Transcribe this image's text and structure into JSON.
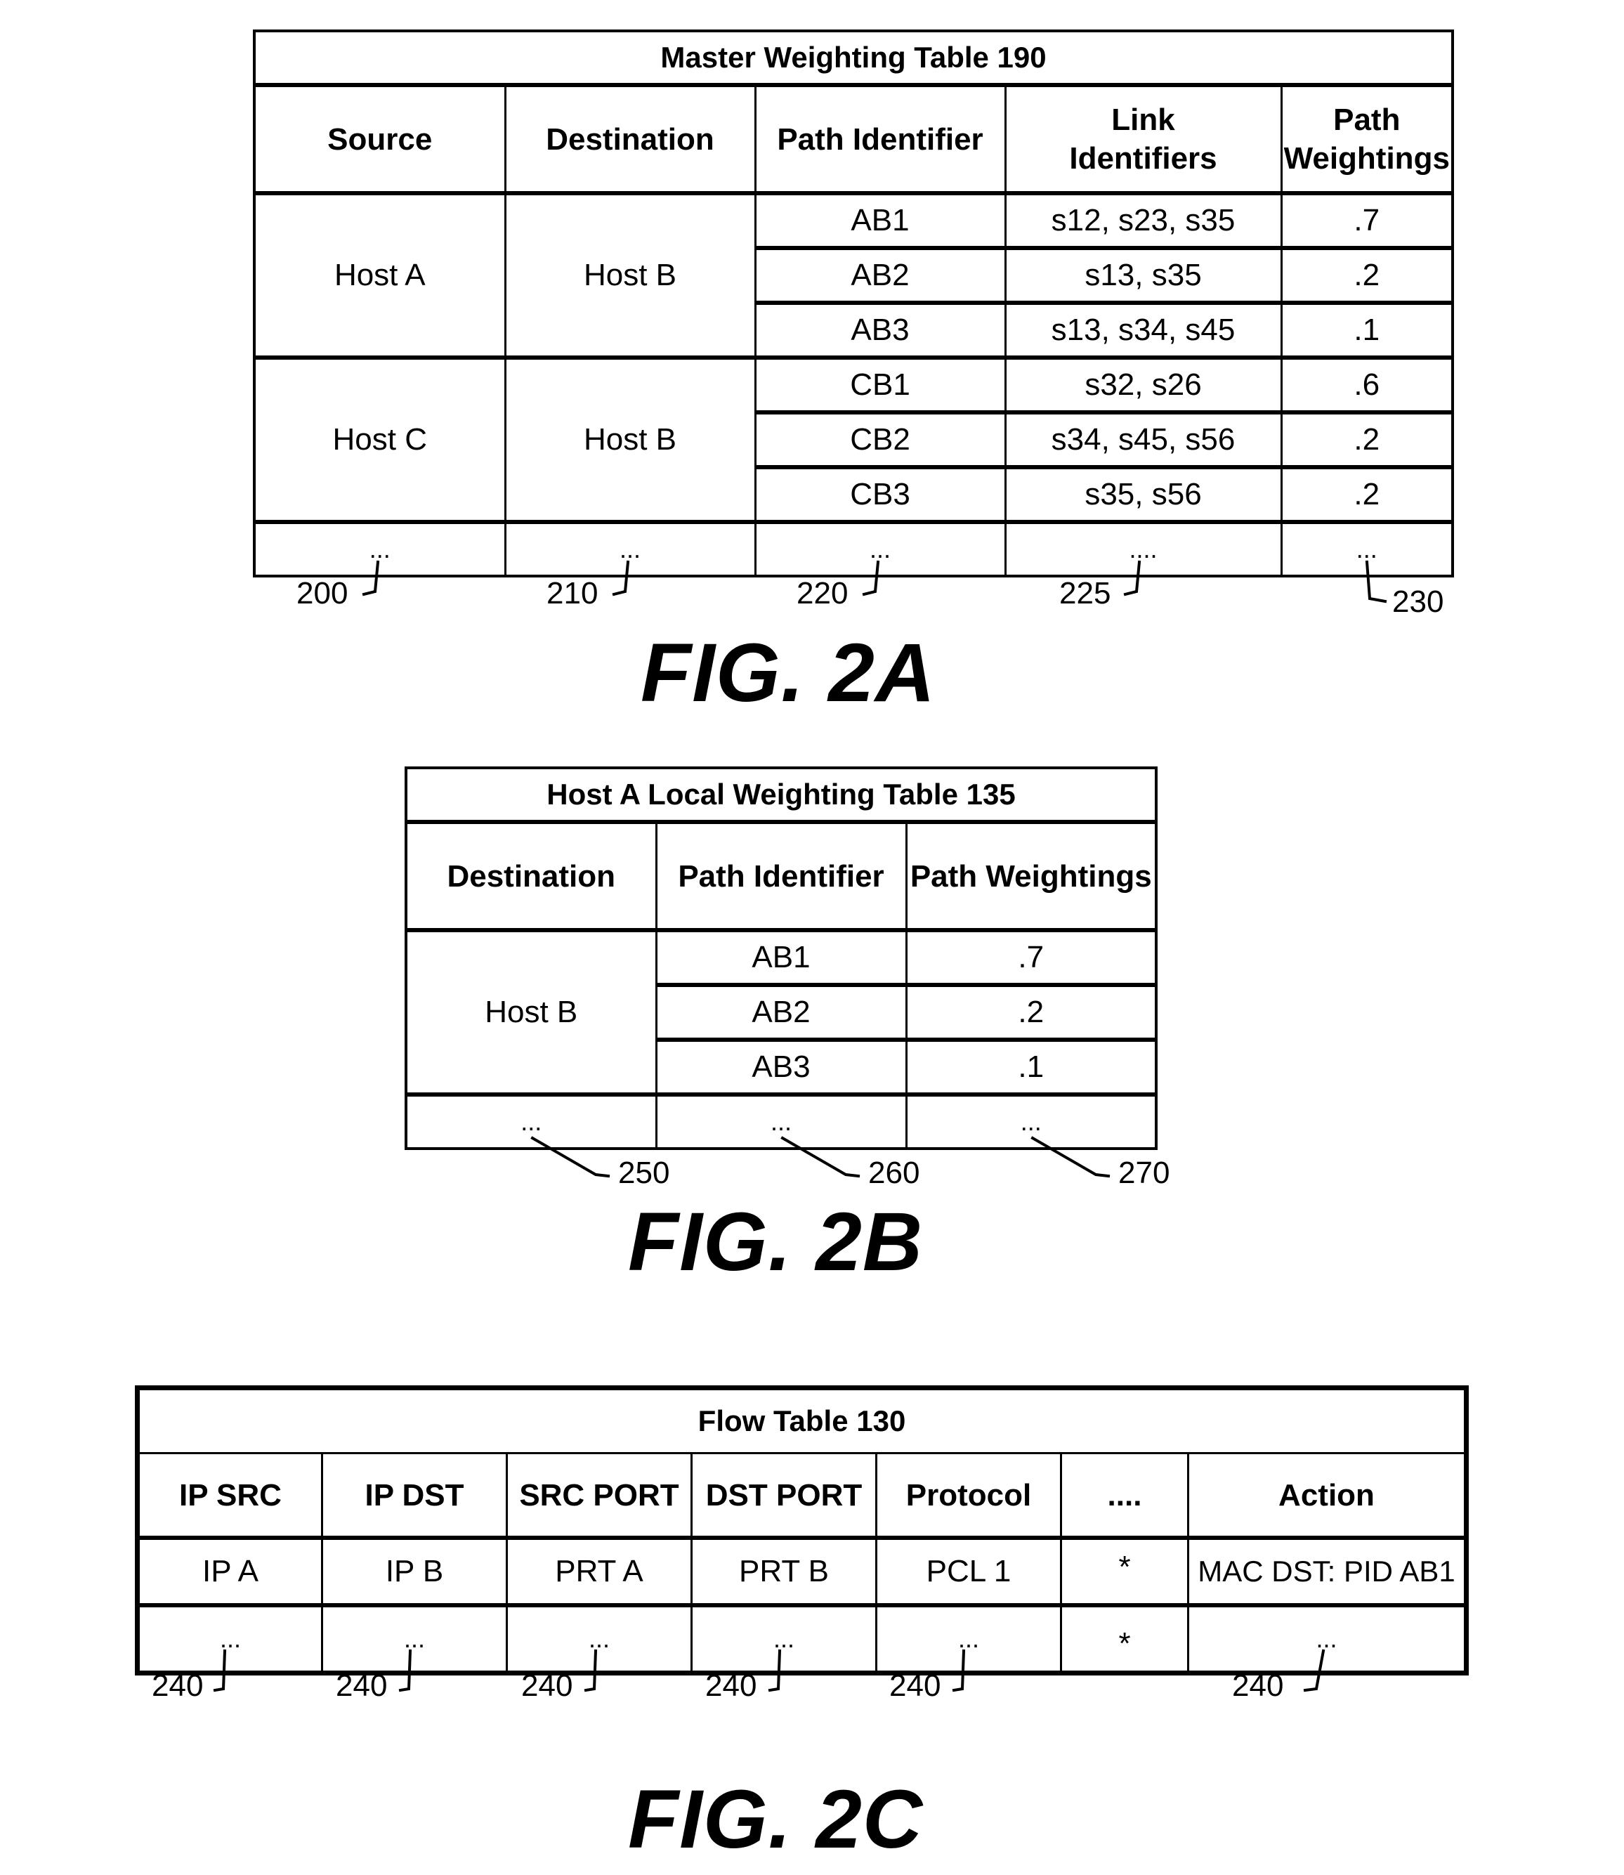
{
  "fig2a": {
    "title": "Master Weighting Table 190",
    "headers": [
      "Source",
      "Destination",
      "Path Identifier",
      "Link Identifiers",
      "Path Weightings"
    ],
    "header_lines": {
      "link_identifiers": [
        "Link",
        "Identifiers"
      ],
      "path_weightings": [
        "Path",
        "Weightings"
      ]
    },
    "groups": [
      {
        "source": "Host A",
        "destination": "Host B",
        "paths": [
          {
            "id": "AB1",
            "links": "s12, s23, s35",
            "weight": ".7"
          },
          {
            "id": "AB2",
            "links": "s13, s35",
            "weight": ".2"
          },
          {
            "id": "AB3",
            "links": "s13, s34, s45",
            "weight": ".1"
          }
        ]
      },
      {
        "source": "Host C",
        "destination": "Host B",
        "paths": [
          {
            "id": "CB1",
            "links": "s32, s26",
            "weight": ".6"
          },
          {
            "id": "CB2",
            "links": "s34, s45, s56",
            "weight": ".2"
          },
          {
            "id": "CB3",
            "links": "s35, s56",
            "weight": ".2"
          }
        ]
      }
    ],
    "ellipsis_row": [
      "...",
      "...",
      "...",
      "....",
      "..."
    ],
    "refs": [
      "200",
      "210",
      "220",
      "225",
      "230"
    ],
    "caption": "FIG. 2A"
  },
  "fig2b": {
    "title": "Host A Local Weighting Table 135",
    "headers": [
      "Destination",
      "Path Identifier",
      "Path Weightings"
    ],
    "group": {
      "destination": "Host B",
      "paths": [
        {
          "id": "AB1",
          "weight": ".7"
        },
        {
          "id": "AB2",
          "weight": ".2"
        },
        {
          "id": "AB3",
          "weight": ".1"
        }
      ]
    },
    "ellipsis_row": [
      "...",
      "...",
      "..."
    ],
    "refs": [
      "250",
      "260",
      "270"
    ],
    "caption": "FIG. 2B"
  },
  "fig2c": {
    "title": "Flow Table 130",
    "headers": [
      "IP SRC",
      "IP DST",
      "SRC PORT",
      "DST PORT",
      "Protocol",
      "....",
      "Action"
    ],
    "rows": [
      [
        "IP A",
        "IP B",
        "PRT A",
        "PRT B",
        "PCL 1",
        "*",
        "MAC DST: PID AB1"
      ],
      [
        "...",
        "...",
        "...",
        "...",
        "...",
        "*",
        "..."
      ]
    ],
    "refs": [
      "240",
      "240",
      "240",
      "240",
      "240",
      "240"
    ],
    "caption": "FIG. 2C"
  }
}
